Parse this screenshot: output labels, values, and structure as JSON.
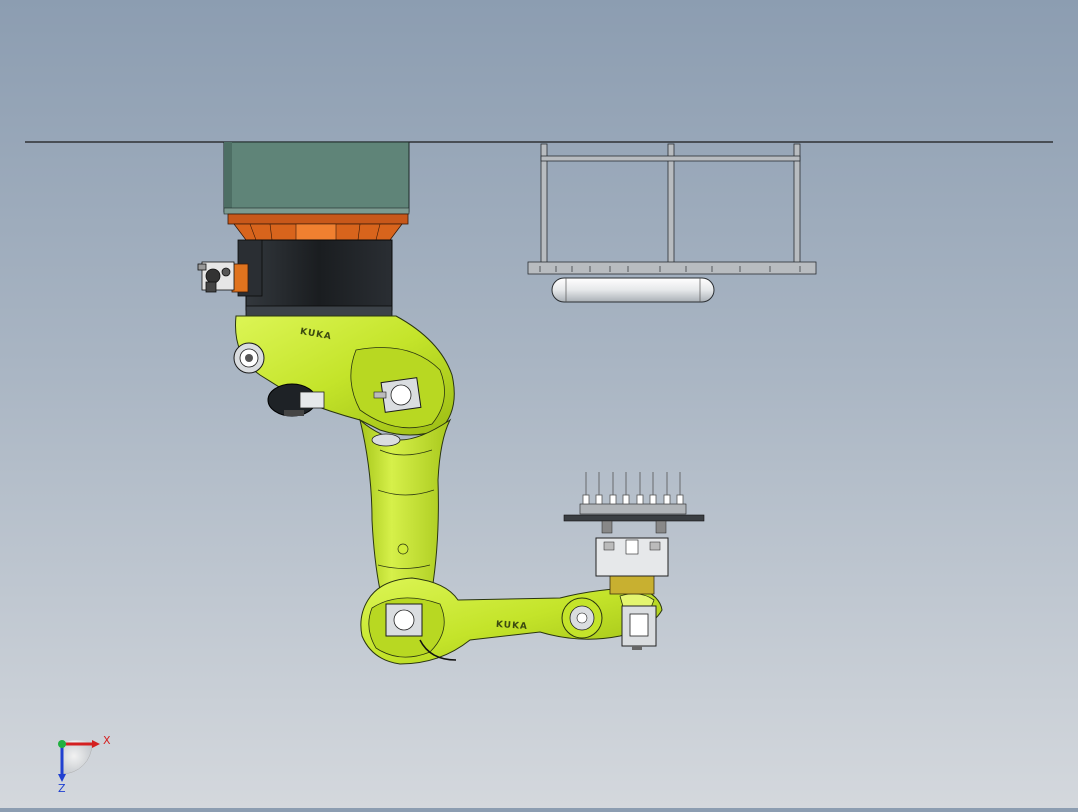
{
  "viewport": {
    "brand_label_upper": "KUKA",
    "brand_label_lower": "KUKA"
  },
  "triad": {
    "x_label": "X",
    "z_label": "Z",
    "x_color": "#d42020",
    "y_color": "#20b040",
    "z_color": "#2040d0"
  },
  "colors": {
    "robot_body": "#c8e82e",
    "robot_shadow": "#9cbc14",
    "motor_dark": "#1e2226",
    "flange_orange": "#d8641c",
    "base_block": "#5f8478",
    "frame_gray": "#9aa0a6",
    "gripper_gray": "#dadde0"
  }
}
